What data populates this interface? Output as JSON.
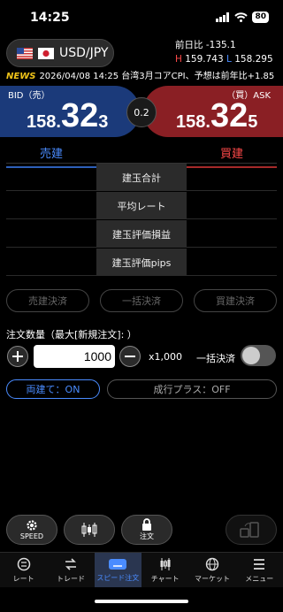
{
  "status": {
    "time": "14:25",
    "battery": "80"
  },
  "pair": {
    "label": "USD/JPY"
  },
  "day": {
    "change_label": "前日比",
    "change_value": "-135.1",
    "high_label": "H",
    "high_value": "159.743",
    "low_label": "L",
    "low_value": "158.295"
  },
  "news": {
    "tag": "NEWS",
    "text": "2026/04/08 14:25 台湾3月コアCPI、予想は前年比+1.85"
  },
  "bid": {
    "label": "BID（売）",
    "big": "158.",
    "mid": "32",
    "small": "3"
  },
  "ask": {
    "label": "（買）ASK",
    "big": "158.",
    "mid": "32",
    "small": "5"
  },
  "spread": "0.2",
  "tabs": {
    "sell": "売建",
    "buy": "買建"
  },
  "position_rows": [
    "建玉合計",
    "平均レート",
    "建玉評価損益",
    "建玉評価pips"
  ],
  "settle": {
    "sell": "売建決済",
    "all": "一括決済",
    "buy": "買建決済"
  },
  "order": {
    "label": "注文数量（最大[新規注文]: ）",
    "quantity": "1000",
    "unit": "x1,000",
    "bulk_label": "一括決済"
  },
  "pills": {
    "both": "両建て：ON",
    "market_plus": "成行プラス：OFF"
  },
  "fabs": {
    "speed": "SPEED",
    "order": "注文"
  },
  "nav": [
    {
      "label": "レート",
      "icon": "rate-icon"
    },
    {
      "label": "トレード",
      "icon": "trade-icon"
    },
    {
      "label": "スピード注文",
      "icon": "speed-order-icon"
    },
    {
      "label": "チャート",
      "icon": "chart-icon"
    },
    {
      "label": "マーケット",
      "icon": "globe-icon"
    },
    {
      "label": "メニュー",
      "icon": "menu-icon"
    }
  ],
  "colors": {
    "bid": "#1b3a7a",
    "ask": "#8a1f24",
    "accent": "#4a8cff",
    "sell_text": "#4a8cff",
    "buy_text": "#ff4a4a"
  }
}
